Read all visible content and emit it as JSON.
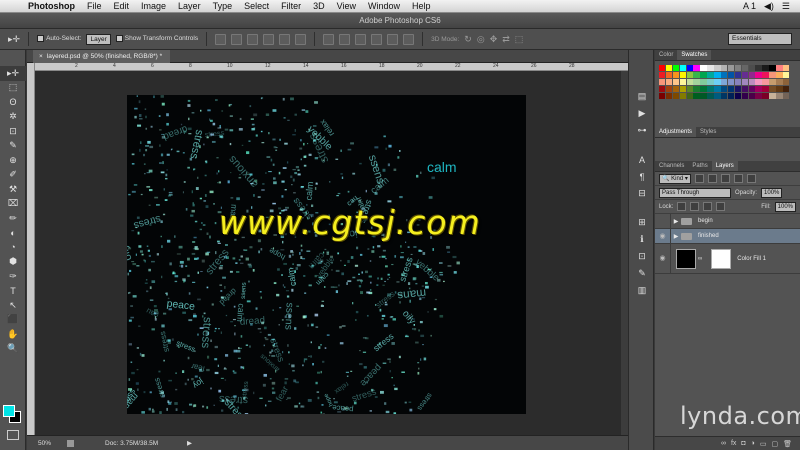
{
  "menubar": {
    "app": "Photoshop",
    "items": [
      "File",
      "Edit",
      "Image",
      "Layer",
      "Type",
      "Select",
      "Filter",
      "3D",
      "View",
      "Window",
      "Help"
    ],
    "right": [
      "A 1",
      "◀)",
      "☰"
    ]
  },
  "titlebar": {
    "title": "Adobe Photoshop CS6"
  },
  "options": {
    "auto_select_label": "Auto-Select:",
    "auto_select_value": "Layer",
    "show_transform_label": "Show Transform Controls",
    "mode_label": "3D Mode:",
    "workspace": "Essentials"
  },
  "tools": [
    "▸✛",
    "⬚",
    "ʘ",
    "✲",
    "⊡",
    "✎",
    "⊕",
    "✐",
    "⚒",
    "⌧",
    "✏",
    "◐",
    "◔",
    "⬢",
    "✑",
    "T",
    "↖",
    "⬛",
    "✋",
    "🔍"
  ],
  "document": {
    "tab_title": "layered.psd @ 50% (finished, RGB/8*) *",
    "ruler_marks": [
      "2",
      "4",
      "6",
      "8",
      "10",
      "12",
      "14",
      "16",
      "18",
      "20",
      "22",
      "24",
      "26",
      "28"
    ],
    "zoom": "50%",
    "doc_size": "Doc: 3.75M/38.5M",
    "canvas_text": "calm",
    "watermark": "www.cgtsj.com",
    "scatter_words": [
      "stress",
      "calm",
      "anxious",
      "dread",
      "stress",
      "yebble",
      "mans",
      "oily",
      "stress",
      "ssens",
      "peace",
      "stress",
      "cau",
      "hope",
      "stress",
      "joy",
      "stress",
      "calm",
      "fear",
      "relax",
      "stress",
      "ssens",
      "stress",
      "calm"
    ]
  },
  "swatches_panel": {
    "tabs": [
      "Color",
      "Swatches"
    ],
    "active_tab": "Swatches",
    "colors": [
      "#ff0000",
      "#ffff00",
      "#00ff00",
      "#00ffff",
      "#0000ff",
      "#ff00ff",
      "#ffffff",
      "#e6e6e6",
      "#cccccc",
      "#b3b3b3",
      "#999999",
      "#808080",
      "#666666",
      "#4d4d4d",
      "#333333",
      "#1a1a1a",
      "#000000",
      "#ff8080",
      "#ffbf80",
      "#ed1c24",
      "#f26522",
      "#f7941d",
      "#fff200",
      "#8dc63f",
      "#39b54a",
      "#00a651",
      "#00a99d",
      "#00aeef",
      "#0072bc",
      "#0054a6",
      "#2e3192",
      "#662d91",
      "#92278f",
      "#ec008c",
      "#ed145b",
      "#f69679",
      "#fbaf5d",
      "#fff799",
      "#f7977a",
      "#f9ad81",
      "#fdc68a",
      "#fff79a",
      "#c4df9b",
      "#a3d39c",
      "#82ca9c",
      "#7accc8",
      "#6dcff6",
      "#7ea7d8",
      "#8493ca",
      "#8882be",
      "#a187be",
      "#bc8dbf",
      "#f49ac2",
      "#f6989d",
      "#c69c6d",
      "#a67c52",
      "#8c6239",
      "#9e0b0f",
      "#a0410d",
      "#a36209",
      "#aba000",
      "#598527",
      "#1a7b30",
      "#007236",
      "#00746b",
      "#0076a3",
      "#004a80",
      "#003471",
      "#1b1464",
      "#440e62",
      "#630460",
      "#9e005d",
      "#9e0039",
      "#754c24",
      "#603913",
      "#42210b",
      "#790000",
      "#7b2e00",
      "#7d4900",
      "#827b00",
      "#406618",
      "#005e20",
      "#005826",
      "#005952",
      "#005b7f",
      "#003663",
      "#002157",
      "#0d004c",
      "#32004b",
      "#4b0049",
      "#7b0046",
      "#7a0026",
      "#c7b299",
      "#998675",
      "#736357"
    ]
  },
  "adjustments_panel": {
    "tabs": [
      "Adjustments",
      "Styles"
    ],
    "active_tab": "Adjustments"
  },
  "layers_panel": {
    "tabs": [
      "Channels",
      "Paths",
      "Layers"
    ],
    "active_tab": "Layers",
    "filter_kind": "Kind",
    "blend_mode": "Pass Through",
    "opacity_label": "Opacity:",
    "opacity_value": "100%",
    "lock_label": "Lock:",
    "fill_label": "Fill:",
    "fill_value": "100%",
    "layers": [
      {
        "name": "begin",
        "type": "group",
        "visible": false
      },
      {
        "name": "finished",
        "type": "group",
        "visible": true,
        "selected": true
      },
      {
        "name": "Color Fill 1",
        "type": "fill",
        "visible": true
      }
    ],
    "footer_icons": [
      "link-icon",
      "fx-icon",
      "mask-icon",
      "adjustment-icon",
      "folder-icon",
      "new-layer-icon",
      "trash-icon"
    ]
  },
  "branding": {
    "logo": "lynda.com"
  }
}
